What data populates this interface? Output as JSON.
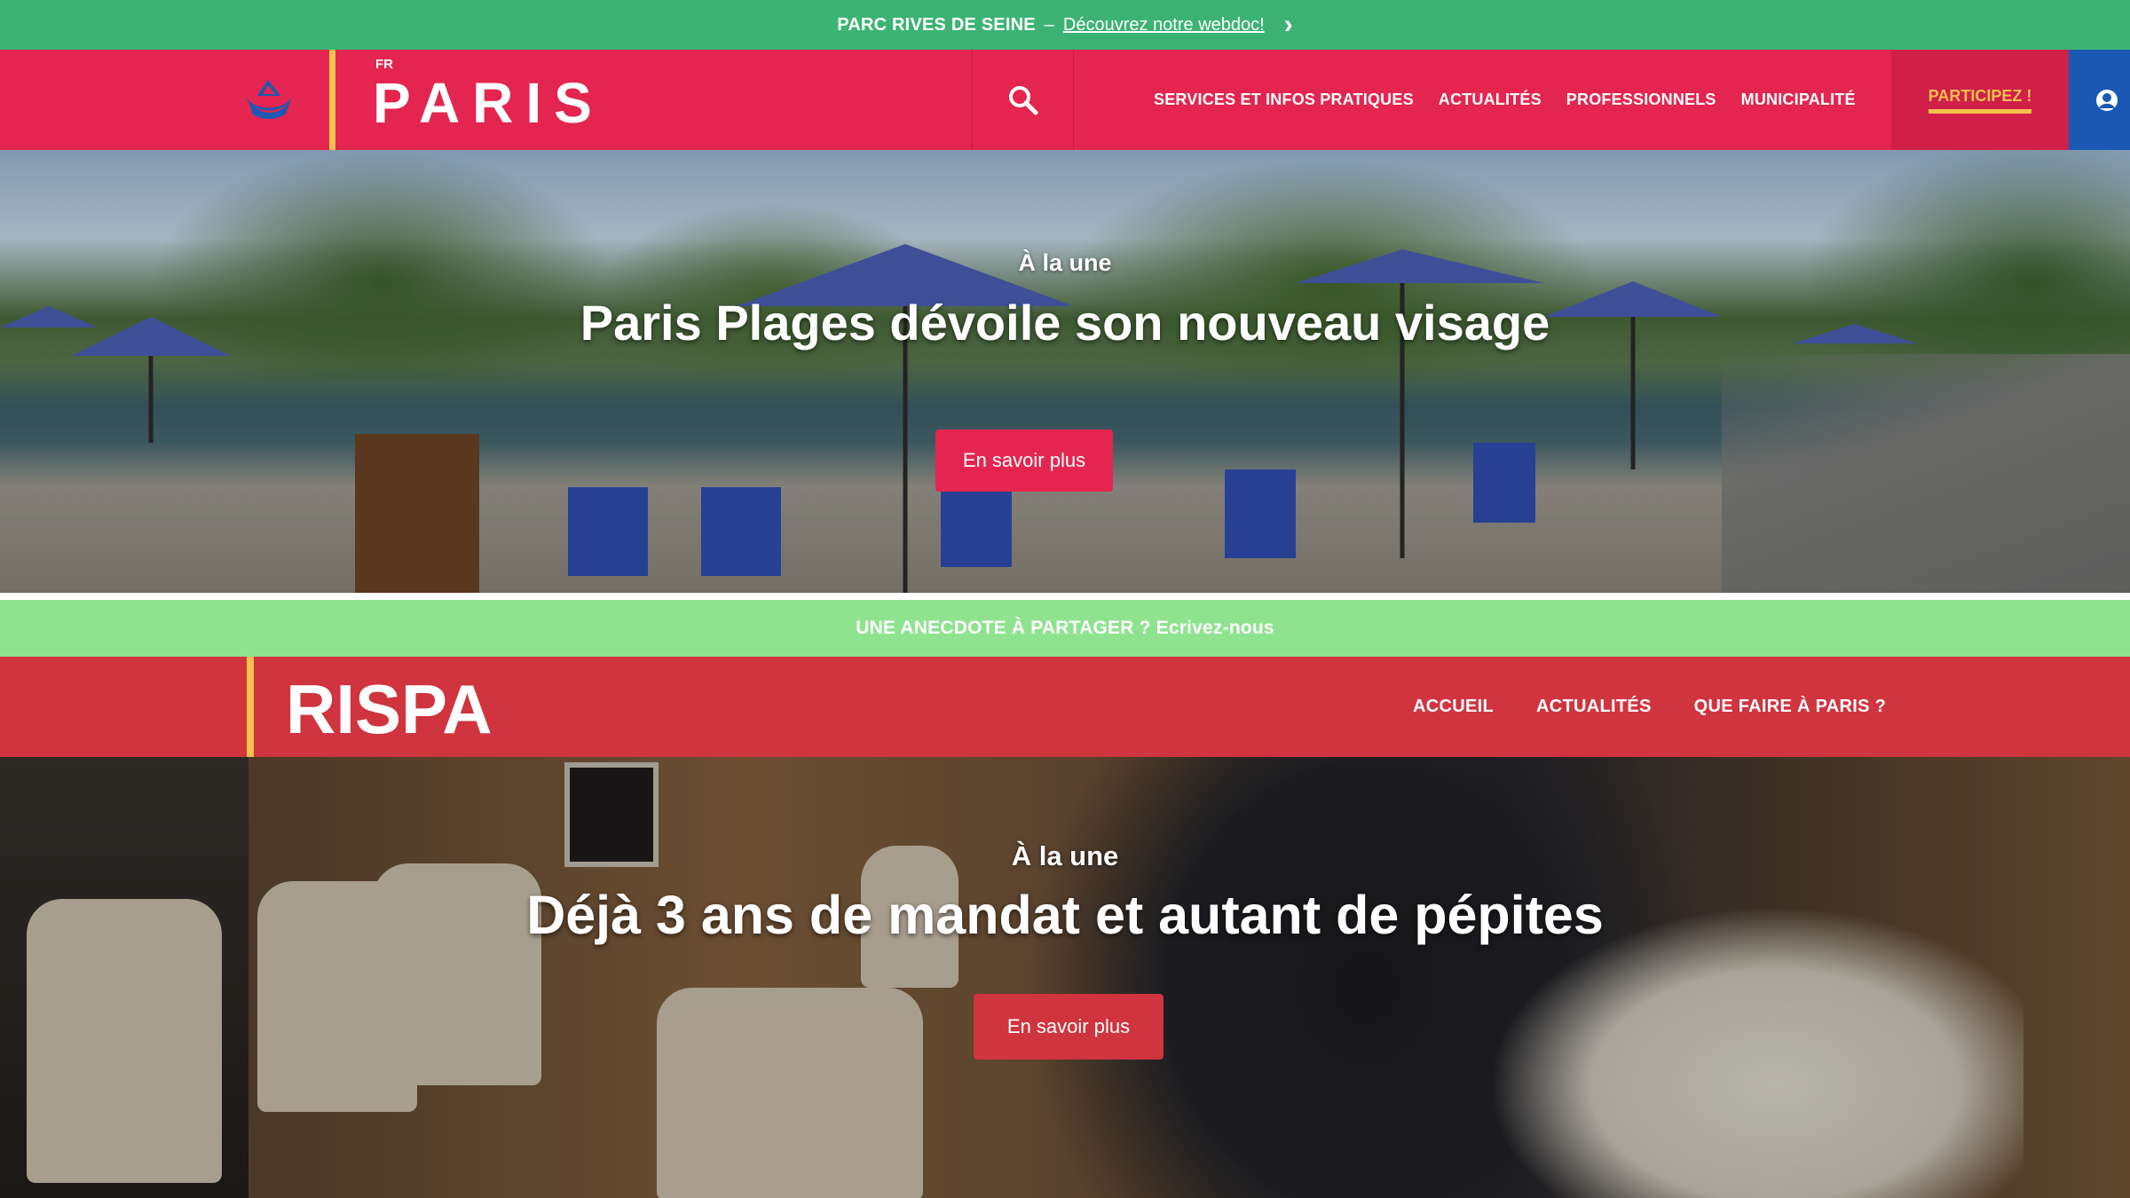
{
  "colors": {
    "topbar_bg": "#3cb373",
    "paris_header_bg": "#e4254f",
    "accent_yellow": "#f5c24d",
    "account_blue": "#1a58b3",
    "anecdote_bg": "#8fe38f",
    "rispa_header_bg": "#d0343f"
  },
  "topbar": {
    "title": "PARC RIVES DE SEINE",
    "separator": "–",
    "link": "Découvrez notre webdoc!",
    "icon": "chevron-right-icon"
  },
  "paris_header": {
    "lang": "FR",
    "brand": "PARIS",
    "logo_icon": "paris-boat-logo-icon",
    "search_icon": "search-icon",
    "nav": [
      "SERVICES ET INFOS PRATIQUES",
      "ACTUALITÉS",
      "PROFESSIONNELS",
      "MUNICIPALITÉ"
    ],
    "cta": "PARTICIPEZ !",
    "account_icon": "user-account-icon"
  },
  "hero1": {
    "kicker": "À la une",
    "title": "Paris Plages dévoile son nouveau visage",
    "button": "En savoir plus"
  },
  "anecdote": {
    "text": "UNE ANECDOTE À PARTAGER ? Ecrivez-nous"
  },
  "rispa_header": {
    "brand": "RISPA",
    "nav": [
      "ACCUEIL",
      "ACTUALITÉS",
      "QUE FAIRE À PARIS ?"
    ]
  },
  "hero2": {
    "kicker": "À la une",
    "title": "Déjà 3 ans de mandat et autant de pépites",
    "button": "En savoir plus"
  }
}
